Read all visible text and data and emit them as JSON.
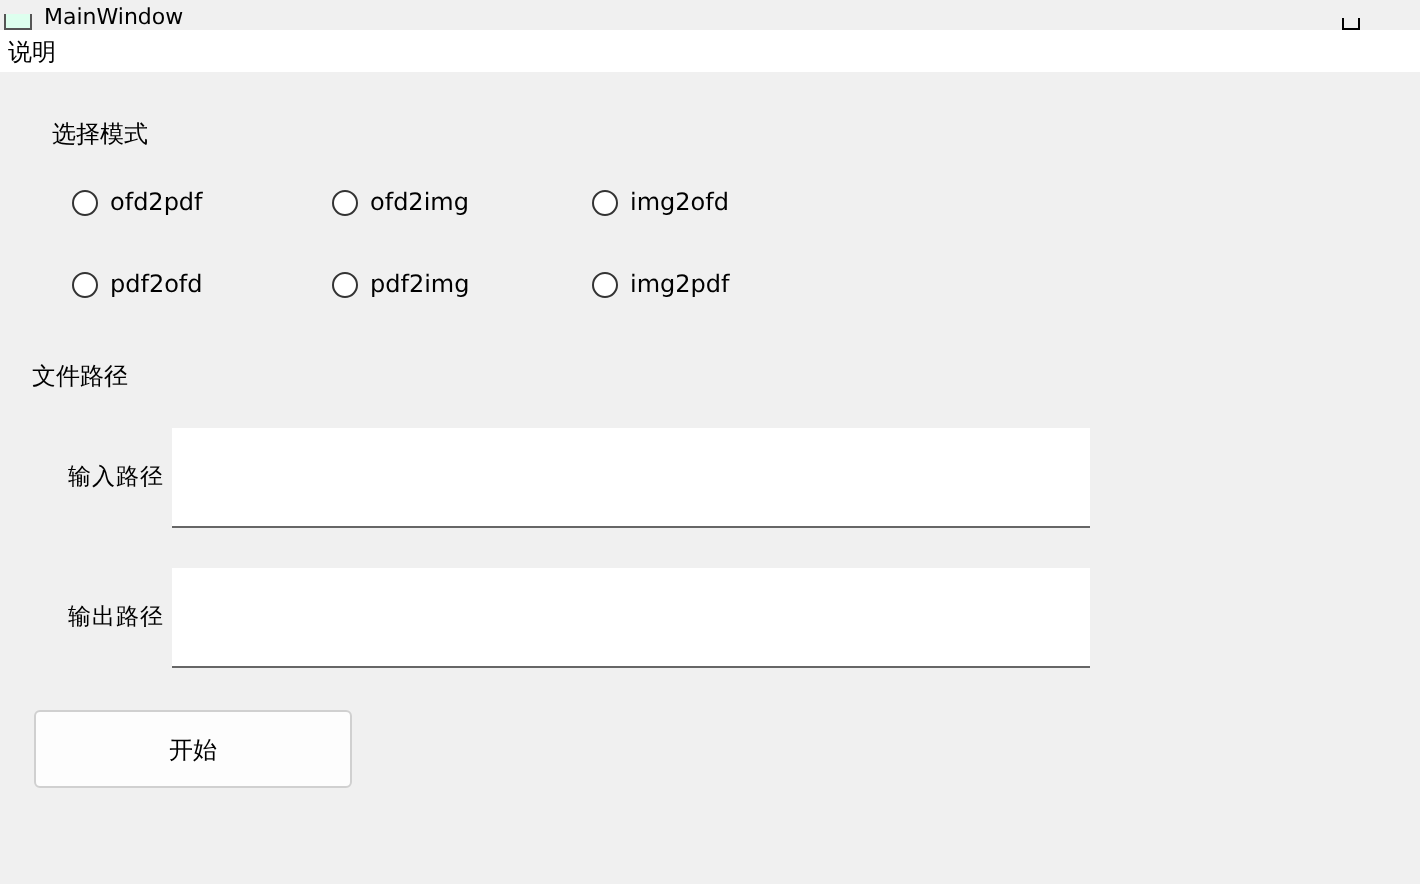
{
  "window": {
    "title": "MainWindow"
  },
  "menu_bar": {
    "items": [
      "说明"
    ]
  },
  "mode_group": {
    "title": "选择模式",
    "options": [
      {
        "label": "ofd2pdf",
        "selected": false
      },
      {
        "label": "ofd2img",
        "selected": false
      },
      {
        "label": "img2ofd",
        "selected": false
      },
      {
        "label": "pdf2ofd",
        "selected": false
      },
      {
        "label": "pdf2img",
        "selected": false
      },
      {
        "label": "img2pdf",
        "selected": false
      }
    ]
  },
  "path_group": {
    "title": "文件路径",
    "fields": [
      {
        "label": "输入路径"
      },
      {
        "label": "输出路径"
      }
    ]
  },
  "buttons": [
    "开始"
  ]
}
